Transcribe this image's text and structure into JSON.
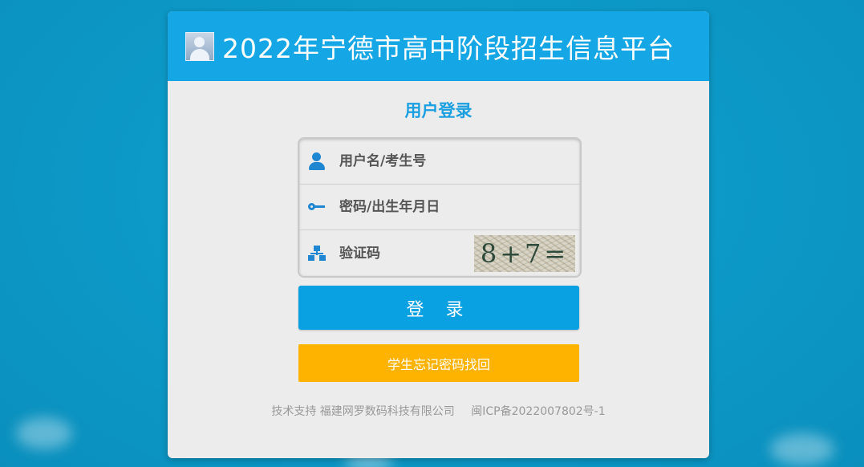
{
  "header": {
    "title": "2022年宁德市高中阶段招生信息平台",
    "logo_icon": "user-avatar-icon"
  },
  "login": {
    "title": "用户登录",
    "username_placeholder": "用户名/考生号",
    "password_placeholder": "密码/出生年月日",
    "captcha_placeholder": "验证码",
    "captcha_text": "8+7=",
    "login_label": "登 录",
    "forgot_label": "学生忘记密码找回"
  },
  "footer": {
    "support": "技术支持 福建网罗数码科技有限公司",
    "icp": "闽ICP备2022007802号-1"
  },
  "colors": {
    "background": "#0d9ac8",
    "header": "#15a6e5",
    "panel": "#ececec",
    "accent_blue": "#1a9fe0",
    "login_button": "#0aa1e2",
    "forgot_button": "#fdb300",
    "footer_text": "#999999"
  }
}
